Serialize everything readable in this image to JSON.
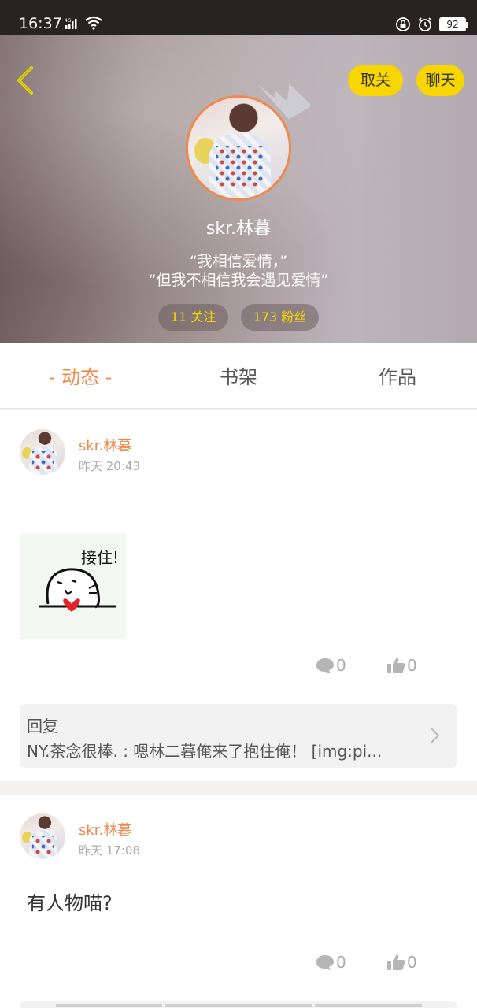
{
  "status_bar": {
    "time": "16:37",
    "network": "4G",
    "battery": "92"
  },
  "header": {
    "unfollow_label": "取关",
    "chat_label": "聊天",
    "username": "skr.林暮",
    "bio_line1": "“我相信爱情，”",
    "bio_line2": "“但我不相信我会遇见爱情”",
    "following": "11 关注",
    "fans": "173 粉丝"
  },
  "tabs": [
    {
      "label": "- 动态 -",
      "active": true
    },
    {
      "label": "书架",
      "active": false
    },
    {
      "label": "作品",
      "active": false
    }
  ],
  "posts": [
    {
      "user": "skr.林暮",
      "time": "昨天 20:43",
      "sticker_text": "接住!",
      "comments": "0",
      "likes": "0",
      "reply_title": "回复",
      "reply_text": "NY.茶念很棒. : 嗯林二暮俺来了抱住俺！ [img:pi..."
    },
    {
      "user": "skr.林暮",
      "time": "昨天 17:08",
      "text": "有人物喵?",
      "comments": "0",
      "likes": "0"
    }
  ],
  "colors": {
    "accent_orange": "#f08a4b",
    "button_yellow": "#f7d600",
    "status_bar": "#262322"
  }
}
